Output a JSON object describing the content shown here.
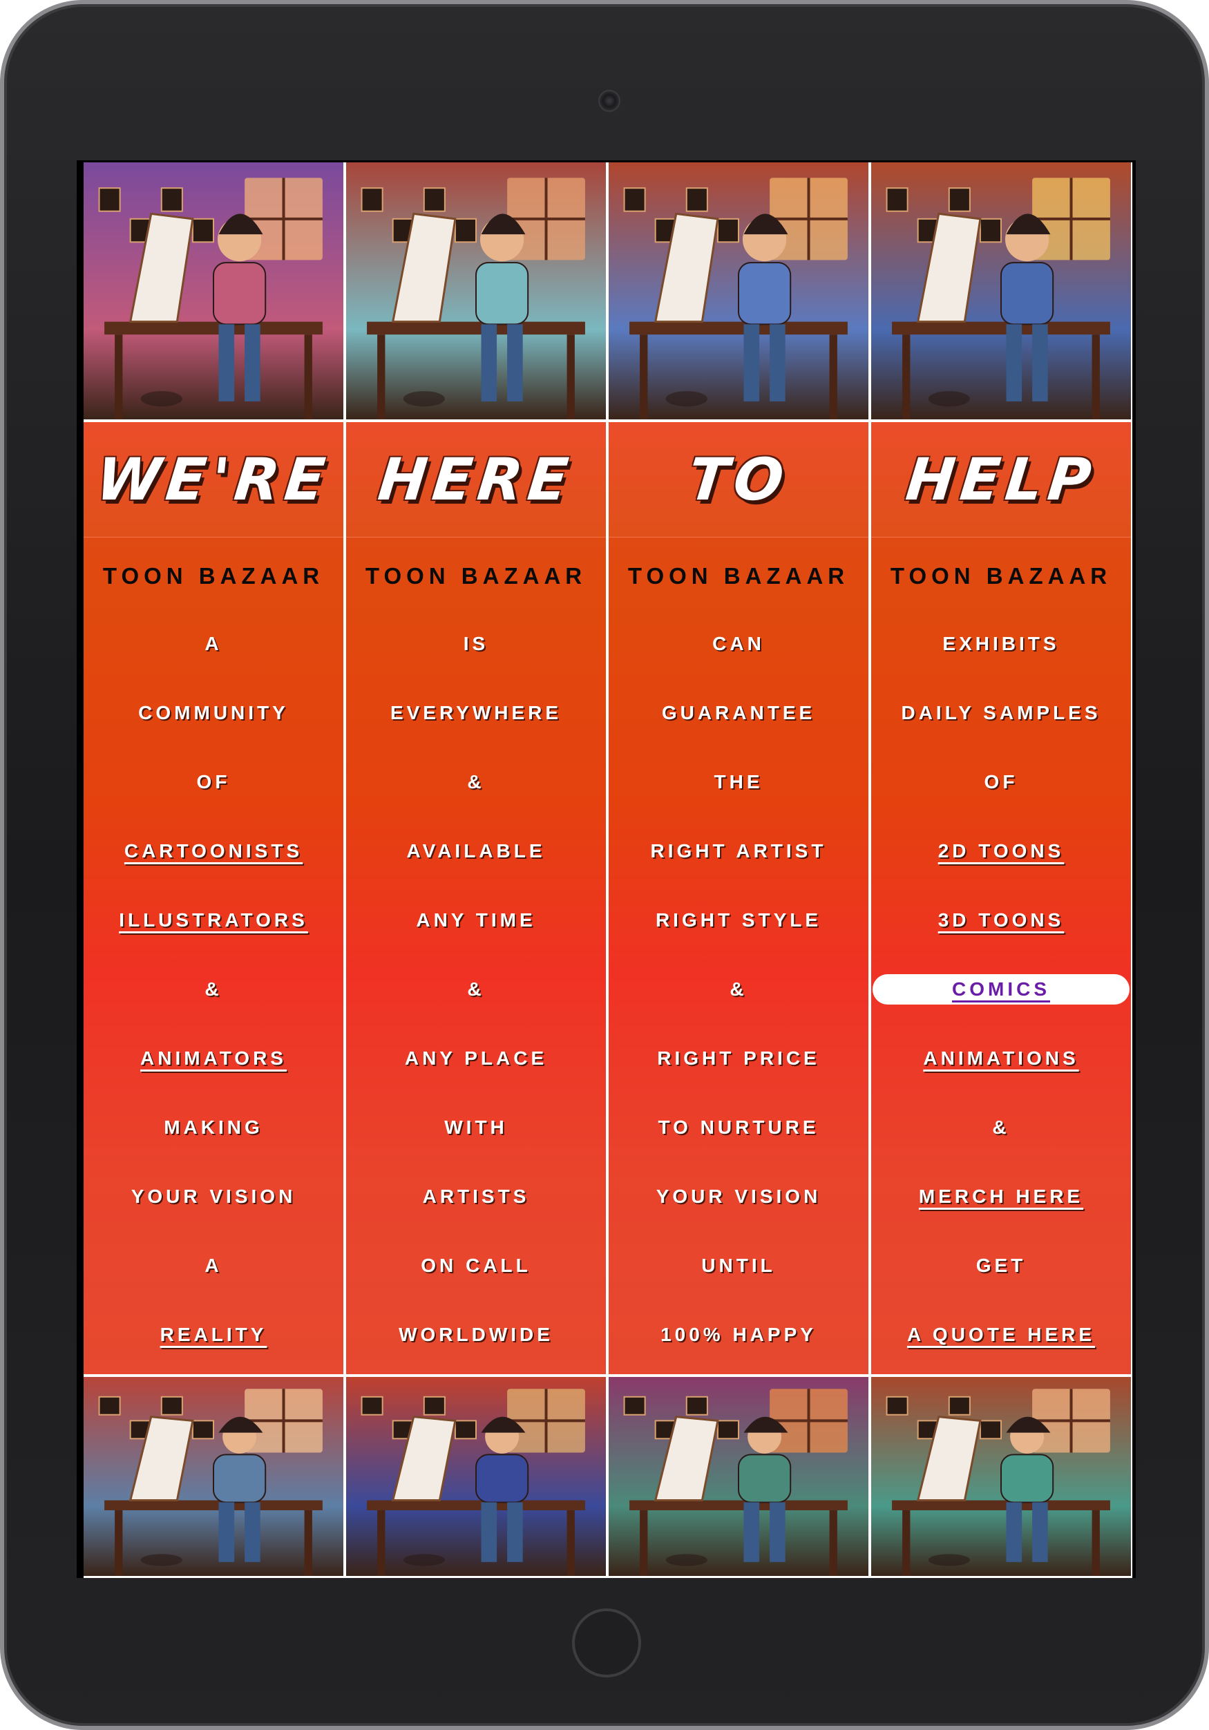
{
  "device": {
    "camera_icon": "camera-icon",
    "home_button_icon": "home-button-icon"
  },
  "columns": [
    {
      "headline": "WE'RE",
      "brand": "TOON BAZAAR",
      "lines": [
        {
          "text": "A",
          "link": false
        },
        {
          "text": "COMMUNITY",
          "link": false
        },
        {
          "text": "OF",
          "link": false
        },
        {
          "text": "CARTOONISTS",
          "link": true
        },
        {
          "text": "ILLUSTRATORS",
          "link": true
        },
        {
          "text": "&",
          "link": false
        },
        {
          "text": "ANIMATORS",
          "link": true
        },
        {
          "text": "MAKING",
          "link": false
        },
        {
          "text": "YOUR VISION",
          "link": false
        },
        {
          "text": "A",
          "link": false
        },
        {
          "text": "REALITY",
          "link": true
        }
      ],
      "top_image": {
        "alt_icon": "artist-woman-at-desk-illustration",
        "palette": [
          "#7a4a9c",
          "#c25a7a",
          "#f2b07a"
        ]
      },
      "bottom_image": {
        "alt_icon": "artist-girl-at-easel-illustration",
        "palette": [
          "#b8443a",
          "#5d7fa6",
          "#f0c090"
        ]
      }
    },
    {
      "headline": "HERE",
      "brand": "TOON BAZAAR",
      "lines": [
        {
          "text": "IS",
          "link": false
        },
        {
          "text": "EVERYWHERE",
          "link": false
        },
        {
          "text": "&",
          "link": false
        },
        {
          "text": "AVAILABLE",
          "link": false
        },
        {
          "text": "ANY TIME",
          "link": false
        },
        {
          "text": "&",
          "link": false
        },
        {
          "text": "ANY PLACE",
          "link": false
        },
        {
          "text": "WITH",
          "link": false
        },
        {
          "text": "ARTISTS",
          "link": false
        },
        {
          "text": "ON CALL",
          "link": false
        },
        {
          "text": "WORLDWIDE",
          "link": false
        }
      ],
      "top_image": {
        "alt_icon": "artist-woman-drawing-tablet-illustration",
        "palette": [
          "#a8453a",
          "#7ab8c0",
          "#e8a070"
        ]
      },
      "bottom_image": {
        "alt_icon": "artist-man-sketching-illustration",
        "palette": [
          "#c0402e",
          "#3a4a9a",
          "#e0b070"
        ]
      }
    },
    {
      "headline": "TO",
      "brand": "TOON BAZAAR",
      "lines": [
        {
          "text": "CAN",
          "link": false
        },
        {
          "text": "GUARANTEE",
          "link": false
        },
        {
          "text": "THE",
          "link": false
        },
        {
          "text": "RIGHT ARTIST",
          "link": false
        },
        {
          "text": "RIGHT STYLE",
          "link": false
        },
        {
          "text": "&",
          "link": false
        },
        {
          "text": "RIGHT PRICE",
          "link": false
        },
        {
          "text": "TO NURTURE",
          "link": false
        },
        {
          "text": "YOUR VISION",
          "link": false
        },
        {
          "text": "UNTIL",
          "link": false
        },
        {
          "text": "100% HAPPY",
          "link": false
        }
      ],
      "top_image": {
        "alt_icon": "old-artist-painting-easel-illustration",
        "palette": [
          "#b0462e",
          "#5a7ac0",
          "#f0b068"
        ]
      },
      "bottom_image": {
        "alt_icon": "punk-artist-painting-illustration",
        "palette": [
          "#8a3a6a",
          "#4a8a7a",
          "#e88a4a"
        ]
      }
    },
    {
      "headline": "HELP",
      "brand": "TOON BAZAAR",
      "lines": [
        {
          "text": "EXHIBITS",
          "link": false
        },
        {
          "text": "DAILY SAMPLES",
          "link": false
        },
        {
          "text": "OF",
          "link": false
        },
        {
          "text": "2D TOONS",
          "link": true
        },
        {
          "text": "3D TOONS",
          "link": true
        },
        {
          "text": "COMICS",
          "link": true,
          "highlight": true
        },
        {
          "text": "ANIMATIONS",
          "link": true
        },
        {
          "text": "&",
          "link": false
        },
        {
          "text": "MERCH HERE",
          "link": true
        },
        {
          "text": "GET",
          "link": false
        },
        {
          "text": "A QUOTE HERE",
          "link": true
        }
      ],
      "top_image": {
        "alt_icon": "artist-woman-painting-canvas-illustration",
        "palette": [
          "#b04a2a",
          "#4a6ab0",
          "#f0c060"
        ]
      },
      "bottom_image": {
        "alt_icon": "artist-woman-sketching-easel-illustration",
        "palette": [
          "#a8482c",
          "#4a9a8a",
          "#f0b080"
        ]
      }
    }
  ],
  "colors": {
    "panel_gradient_top": "#e04a0e",
    "panel_gradient_mid": "#f03224",
    "headline_text": "#ffffff",
    "brand_text": "#0a0a0a",
    "link_highlight_text": "#6a1ea8"
  }
}
